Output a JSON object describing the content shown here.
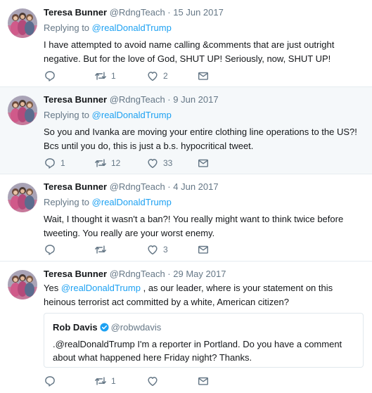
{
  "tweets": [
    {
      "name": "Teresa Bunner",
      "handle": "@RdngTeach",
      "sep": "·",
      "date": "15 Jun 2017",
      "replying_prefix": "Replying to",
      "replying_to": "@realDonaldTrump",
      "text": "I have attempted to avoid name calling &comments that are just outright negative. But for the love of God, SHUT UP! Seriously, now, SHUT UP!",
      "replies": "",
      "retweets": "1",
      "likes": "2"
    },
    {
      "name": "Teresa Bunner",
      "handle": "@RdngTeach",
      "sep": "·",
      "date": "9 Jun 2017",
      "replying_prefix": "Replying to",
      "replying_to": "@realDonaldTrump",
      "text": "So you and Ivanka are moving your entire clothing line operations to the US?! Bcs until you do, this is just a b.s. hypocritical tweet.",
      "replies": "1",
      "retweets": "12",
      "likes": "33"
    },
    {
      "name": "Teresa Bunner",
      "handle": "@RdngTeach",
      "sep": "·",
      "date": "4 Jun 2017",
      "replying_prefix": "Replying to",
      "replying_to": "@realDonaldTrump",
      "text": "Wait, I thought it wasn't a ban?! You really might want to think twice before tweeting. You really are your worst enemy.",
      "replies": "",
      "retweets": "",
      "likes": "3"
    },
    {
      "name": "Teresa Bunner",
      "handle": "@RdngTeach",
      "sep": "·",
      "date": "29 May 2017",
      "text_prefix": "Yes ",
      "text_mention": "@realDonaldTrump",
      "text_rest": " , as our leader, where is your statement on this heinous terrorist act committed by a white, American citizen?",
      "quote": {
        "name": "Rob Davis",
        "handle": "@robwdavis",
        "text": ".@realDonaldTrump I'm a reporter in Portland. Do you have a comment about what happened here Friday night? Thanks."
      },
      "replies": "",
      "retweets": "1",
      "likes": ""
    }
  ],
  "colors": {
    "accent": "#1da1f2",
    "muted": "#657786",
    "highlight_bg": "#f5f8fa",
    "border": "#e6ecf0"
  },
  "icons": [
    "reply-icon",
    "retweet-icon",
    "like-icon",
    "dm-icon",
    "verified-icon"
  ]
}
